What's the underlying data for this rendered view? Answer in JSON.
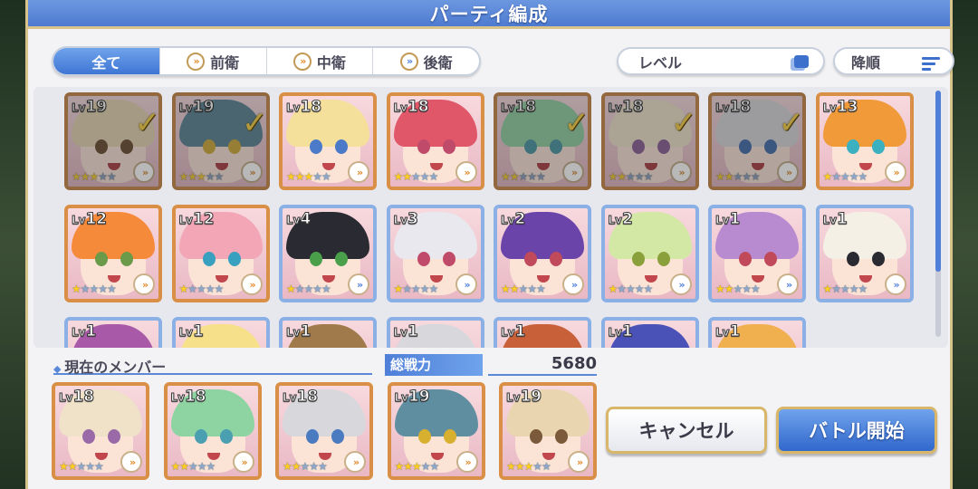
{
  "title": "パーティ編成",
  "filters": {
    "tabs": [
      {
        "label": "全て",
        "active": true
      },
      {
        "label": "前衛",
        "active": false
      },
      {
        "label": "中衛",
        "active": false
      },
      {
        "label": "後衛",
        "active": false
      }
    ],
    "sort_label": "レベル",
    "order_label": "降順"
  },
  "roster": [
    {
      "lv": "19",
      "stars": 3,
      "selected": true,
      "hair": "#e9d6b0",
      "eye": "#7a5a3a",
      "badge": "»",
      "frame": "bronze"
    },
    {
      "lv": "19",
      "stars": 3,
      "selected": true,
      "hair": "#5f8ea0",
      "eye": "#d8b030",
      "badge": "»",
      "frame": "bronze"
    },
    {
      "lv": "18",
      "stars": 3,
      "selected": false,
      "hair": "#f4e09a",
      "eye": "#4b7ac8",
      "badge": "»",
      "frame": "gold"
    },
    {
      "lv": "18",
      "stars": 2,
      "selected": false,
      "hair": "#e0576a",
      "eye": "#c04a6a",
      "badge": "»",
      "frame": "gold"
    },
    {
      "lv": "18",
      "stars": 2,
      "selected": true,
      "hair": "#8ed4a2",
      "eye": "#4aa0b0",
      "badge": "»",
      "frame": "bronze"
    },
    {
      "lv": "18",
      "stars": 2,
      "selected": true,
      "hair": "#f0e2c8",
      "eye": "#9a6aa8",
      "badge": "»",
      "frame": "bronze"
    },
    {
      "lv": "18",
      "stars": 2,
      "selected": true,
      "hair": "#d8d8dc",
      "eye": "#4a7ac0",
      "badge": "»",
      "frame": "bronze"
    },
    {
      "lv": "13",
      "stars": 1,
      "selected": false,
      "hair": "#f09a3a",
      "eye": "#3ab0c0",
      "badge": "»",
      "frame": "gold"
    },
    {
      "lv": "12",
      "stars": 1,
      "selected": false,
      "hair": "#f58a3a",
      "eye": "#6a9a4a",
      "badge": "»",
      "frame": "gold"
    },
    {
      "lv": "12",
      "stars": 1,
      "selected": false,
      "hair": "#f2a6b6",
      "eye": "#3aa0c0",
      "badge": "»",
      "frame": "gold"
    },
    {
      "lv": "4",
      "stars": 1,
      "selected": false,
      "hair": "#2a2a32",
      "eye": "#4aa04a",
      "badge": "»",
      "frame": "blue"
    },
    {
      "lv": "3",
      "stars": 1,
      "selected": false,
      "hair": "#e8e8ee",
      "eye": "#c04a6a",
      "badge": "»",
      "frame": "blue"
    },
    {
      "lv": "2",
      "stars": 2,
      "selected": false,
      "hair": "#6a44a8",
      "eye": "#c04a5a",
      "badge": "»",
      "frame": "blue"
    },
    {
      "lv": "2",
      "stars": 1,
      "selected": false,
      "hair": "#d4e8a6",
      "eye": "#8aa03a",
      "badge": "»",
      "frame": "blue"
    },
    {
      "lv": "1",
      "stars": 2,
      "selected": false,
      "hair": "#b88ad0",
      "eye": "#c04a5a",
      "badge": "»",
      "frame": "blue"
    },
    {
      "lv": "1",
      "stars": 1,
      "selected": false,
      "hair": "#f4f0e6",
      "eye": "#2a2a32",
      "badge": "»",
      "frame": "blue"
    },
    {
      "lv": "1",
      "stars": 1,
      "selected": false,
      "hair": "#a85aa8",
      "eye": "#5a3a3a",
      "badge": "»",
      "frame": "blue"
    },
    {
      "lv": "1",
      "stars": 1,
      "selected": false,
      "hair": "#f6e08a",
      "eye": "#5a3a3a",
      "badge": "»",
      "frame": "blue"
    },
    {
      "lv": "1",
      "stars": 1,
      "selected": false,
      "hair": "#a07a4a",
      "eye": "#5a3a3a",
      "badge": "»",
      "frame": "blue"
    },
    {
      "lv": "1",
      "stars": 1,
      "selected": false,
      "hair": "#d8d8dc",
      "eye": "#5a3a3a",
      "badge": "»",
      "frame": "blue"
    },
    {
      "lv": "1",
      "stars": 1,
      "selected": false,
      "hair": "#c8603a",
      "eye": "#5a3a3a",
      "badge": "»",
      "frame": "blue"
    },
    {
      "lv": "1",
      "stars": 1,
      "selected": false,
      "hair": "#4a52b8",
      "eye": "#5a3a3a",
      "badge": "»",
      "frame": "blue"
    },
    {
      "lv": "1",
      "stars": 1,
      "selected": false,
      "hair": "#f0b050",
      "eye": "#5a3a3a",
      "badge": "»",
      "frame": "blue"
    }
  ],
  "party": {
    "label": "現在のメンバー",
    "power_label": "総戦力",
    "power_value": "5680",
    "members": [
      {
        "lv": "18",
        "stars": 2,
        "hair": "#f0e2c8",
        "eye": "#9a6aa8",
        "badge": "»"
      },
      {
        "lv": "18",
        "stars": 2,
        "hair": "#8ed4a2",
        "eye": "#4aa0b0",
        "badge": "»"
      },
      {
        "lv": "18",
        "stars": 2,
        "hair": "#d8d8dc",
        "eye": "#4a7ac0",
        "badge": "»"
      },
      {
        "lv": "19",
        "stars": 3,
        "hair": "#5f8ea0",
        "eye": "#d8b030",
        "badge": "»"
      },
      {
        "lv": "19",
        "stars": 3,
        "hair": "#e9d6b0",
        "eye": "#7a5a3a",
        "badge": "»"
      }
    ]
  },
  "buttons": {
    "cancel": "キャンセル",
    "battle": "バトル開始"
  }
}
